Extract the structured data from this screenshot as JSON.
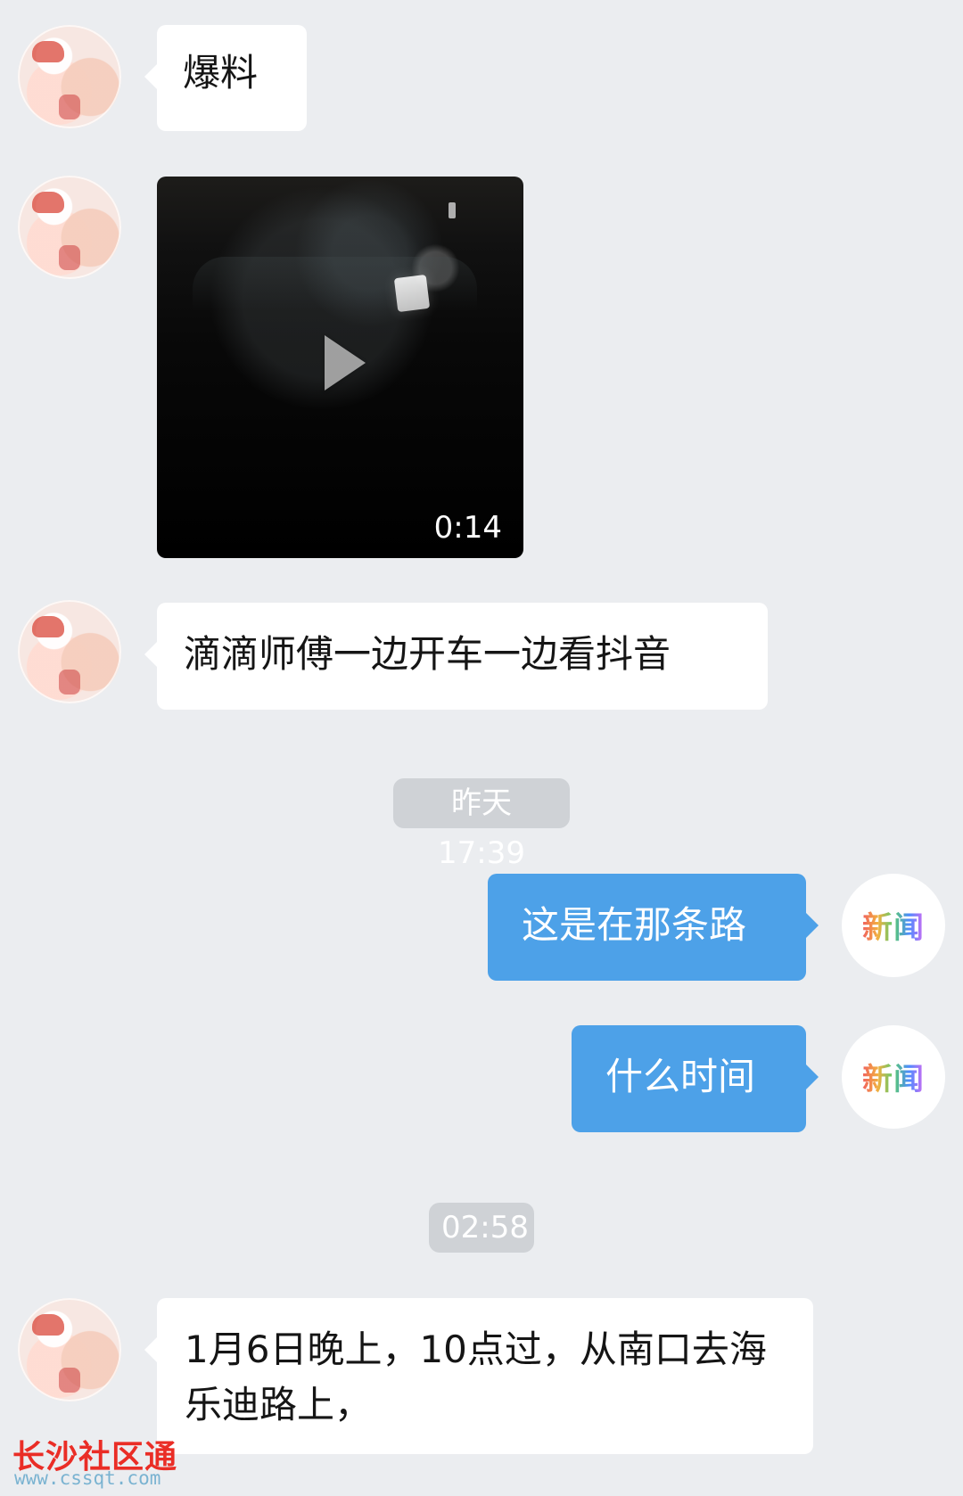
{
  "messages": [
    {
      "text": "爆料"
    },
    {
      "video_duration": "0:14"
    },
    {
      "text": "滴滴师傅一边开车一边看抖音"
    },
    {
      "timestamp": "昨天 17:39"
    },
    {
      "text": "这是在那条路"
    },
    {
      "text": "什么时间"
    },
    {
      "timestamp": "02:58"
    },
    {
      "text": "1月6日晚上，10点过，从南口去海乐迪路上，"
    }
  ],
  "self_avatar_text": "新闻",
  "watermark": {
    "main": "长沙社区通",
    "url": "www.cssqt.com"
  },
  "colors": {
    "background": "#ebedf0",
    "incoming_bubble": "#ffffff",
    "outgoing_bubble": "#4da1e8",
    "timestamp_bg": "#cfd2d6",
    "watermark_red": "#ea2d26"
  }
}
